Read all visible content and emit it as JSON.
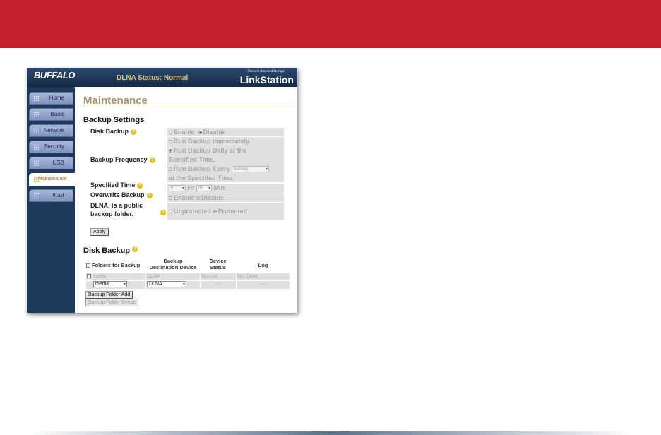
{
  "header": {
    "logo": "BUFFALO",
    "status": "DLNA Status: Normal",
    "product_tagline": "Network Attached Storage",
    "product": "LinkStation"
  },
  "sidebar": {
    "items": [
      {
        "label": "Home"
      },
      {
        "label": "Basic"
      },
      {
        "label": "Network"
      },
      {
        "label": "Security"
      },
      {
        "label": "USB"
      },
      {
        "label": "Maintenance"
      },
      {
        "label": "PCast"
      }
    ]
  },
  "page": {
    "title": "Maintenance"
  },
  "backup_settings": {
    "heading": "Backup Settings",
    "disk_backup": {
      "label": "Disk Backup",
      "opt1": "Enable",
      "opt2": "Disable",
      "selected": "Disable"
    },
    "frequency": {
      "label": "Backup Frequency",
      "opt1": "Run Backup Immediately.",
      "opt2a": "Run Backup Daily at the",
      "opt2b": "Specified Time.",
      "opt3a": "Run Backup Every",
      "day": "Sunday",
      "opt3b": "at the Specified Time.",
      "selected": "daily"
    },
    "time": {
      "label": "Specified Time",
      "hour": "0",
      "hr": "Hr",
      "minute": "00",
      "min": "Min"
    },
    "overwrite": {
      "label": "Overwrite Backup",
      "opt1": "Enable",
      "opt2": "Disable",
      "selected": "Disable"
    },
    "dlna": {
      "label1": "DLNA, is a public",
      "label2": "backup folder.",
      "opt1": "Unprotected",
      "opt2": "Protected",
      "selected": "Protected"
    },
    "apply": "Apply"
  },
  "disk_backup": {
    "heading": "Disk Backup",
    "columns": {
      "folders": "Folders for Backup",
      "dest1": "Backup",
      "dest2": "Destination Device",
      "status1": "Device",
      "status2": "Status",
      "log": "Log"
    },
    "rows": [
      {
        "folder": "media",
        "dest": "DLNA",
        "status": "Normal",
        "log": "Not Done"
      }
    ],
    "new_row": {
      "folder": "media",
      "dest": "DLNA",
      "status": "----",
      "log": "----"
    },
    "add": "Backup Folder Add",
    "delete": "Backup Folder Delete"
  }
}
